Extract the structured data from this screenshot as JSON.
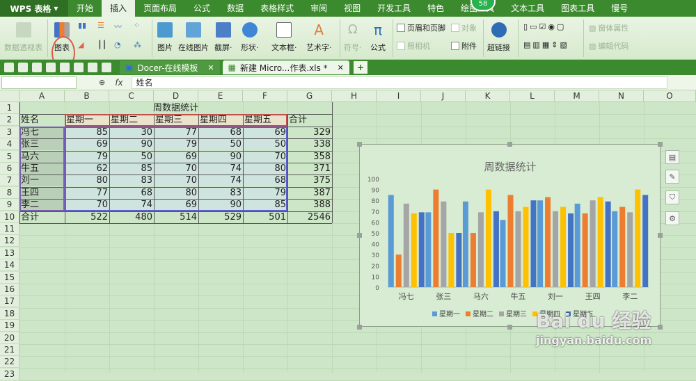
{
  "app": {
    "name": "WPS 表格"
  },
  "menu": [
    "开始",
    "插入",
    "页面布局",
    "公式",
    "数据",
    "表格样式",
    "审阅",
    "视图",
    "开发工具",
    "特色",
    "绘图工具",
    "文本工具",
    "图表工具",
    "慢号"
  ],
  "menu_active": 1,
  "badge": "58",
  "ribbon": {
    "big": [
      {
        "label": "数据透视表",
        "disabled": true
      },
      {
        "label": "图表",
        "disabled": false
      },
      {
        "label": "图片",
        "disabled": false
      },
      {
        "label": "在线图片",
        "disabled": false
      },
      {
        "label": "截屏·",
        "disabled": false
      },
      {
        "label": "形状·",
        "disabled": false
      },
      {
        "label": "文本框·",
        "disabled": false
      },
      {
        "label": "艺术字·",
        "disabled": false
      },
      {
        "label": "符号·",
        "disabled": true
      },
      {
        "label": "公式",
        "disabled": false
      },
      {
        "label": "超链接",
        "disabled": false
      }
    ],
    "small": [
      {
        "label": "页眉和页脚",
        "disabled": false
      },
      {
        "label": "对象",
        "disabled": true
      },
      {
        "label": "照相机",
        "disabled": true
      },
      {
        "label": "附件",
        "disabled": false
      },
      {
        "label": "窗体属性",
        "disabled": true
      },
      {
        "label": "编辑代码",
        "disabled": true
      }
    ]
  },
  "tabs": [
    {
      "label": "Docer-在线模板",
      "active": false
    },
    {
      "label": "新建 Micro...作表.xls *",
      "active": true
    }
  ],
  "formula": {
    "name_box": "",
    "fx": "fx",
    "value": "姓名"
  },
  "columns": [
    "A",
    "B",
    "C",
    "D",
    "E",
    "F",
    "G",
    "H",
    "I",
    "J",
    "K",
    "L",
    "M",
    "N",
    "O"
  ],
  "rows": [
    "1",
    "2",
    "3",
    "4",
    "5",
    "6",
    "7",
    "8",
    "9",
    "10",
    "11",
    "12",
    "13",
    "14",
    "15",
    "16",
    "17",
    "18",
    "19",
    "20",
    "21",
    "22",
    "23"
  ],
  "sheet": {
    "title": "周数据统计",
    "headers": [
      "姓名",
      "星期一",
      "星期二",
      "星期三",
      "星期四",
      "星期五",
      "合计"
    ],
    "data": [
      [
        "冯七",
        "85",
        "30",
        "77",
        "68",
        "69",
        "329"
      ],
      [
        "张三",
        "69",
        "90",
        "79",
        "50",
        "50",
        "338"
      ],
      [
        "马六",
        "79",
        "50",
        "69",
        "90",
        "70",
        "358"
      ],
      [
        "牛五",
        "62",
        "85",
        "70",
        "74",
        "80",
        "371"
      ],
      [
        "刘一",
        "80",
        "83",
        "70",
        "74",
        "68",
        "375"
      ],
      [
        "王四",
        "77",
        "68",
        "80",
        "83",
        "79",
        "387"
      ],
      [
        "李二",
        "70",
        "74",
        "69",
        "90",
        "85",
        "388"
      ],
      [
        "合计",
        "522",
        "480",
        "514",
        "529",
        "501",
        "2546"
      ]
    ]
  },
  "chart_data": {
    "type": "bar",
    "title": "周数据统计",
    "categories": [
      "冯七",
      "张三",
      "马六",
      "牛五",
      "刘一",
      "王四",
      "李二"
    ],
    "series": [
      {
        "name": "星期一",
        "values": [
          85,
          69,
          79,
          62,
          80,
          77,
          70
        ]
      },
      {
        "name": "星期二",
        "values": [
          30,
          90,
          50,
          85,
          83,
          68,
          74
        ]
      },
      {
        "name": "星期三",
        "values": [
          77,
          79,
          69,
          70,
          70,
          80,
          69
        ]
      },
      {
        "name": "星期四",
        "values": [
          68,
          50,
          90,
          74,
          74,
          83,
          90
        ]
      },
      {
        "name": "星期五",
        "values": [
          69,
          50,
          70,
          80,
          68,
          79,
          85
        ]
      }
    ],
    "colors": [
      "#5b9bd5",
      "#ed7d31",
      "#a5a5a5",
      "#ffc000",
      "#4472c4"
    ],
    "ylim": [
      0,
      100
    ],
    "yticks": [
      "0",
      "10",
      "20",
      "30",
      "40",
      "50",
      "60",
      "70",
      "80",
      "90",
      "100"
    ],
    "grid": false,
    "legend": "bottom"
  },
  "watermark": "Bai du 经验\njingyan.baidu.com"
}
